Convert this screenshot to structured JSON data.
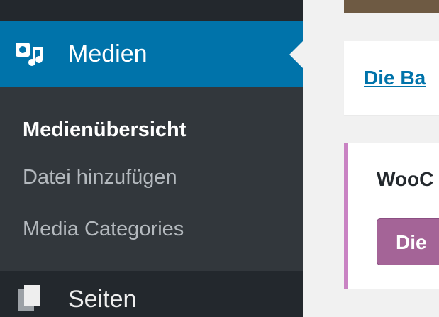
{
  "sidebar": {
    "active_menu": {
      "label": "Medien",
      "icon": "media-icon"
    },
    "submenu": [
      {
        "label": "Medienübersicht",
        "current": true
      },
      {
        "label": "Datei hinzufügen",
        "current": false
      },
      {
        "label": "Media Categories",
        "current": false
      }
    ],
    "next_menu": {
      "label": "Seiten",
      "icon": "pages-icon"
    }
  },
  "content": {
    "notice_link": "Die Ba",
    "woo_title": "WooC",
    "woo_button": "Die"
  },
  "colors": {
    "sidebar_bg": "#32373c",
    "active_bg": "#0073aa",
    "woo_accent": "#c983c3",
    "woo_button": "#a46497"
  }
}
